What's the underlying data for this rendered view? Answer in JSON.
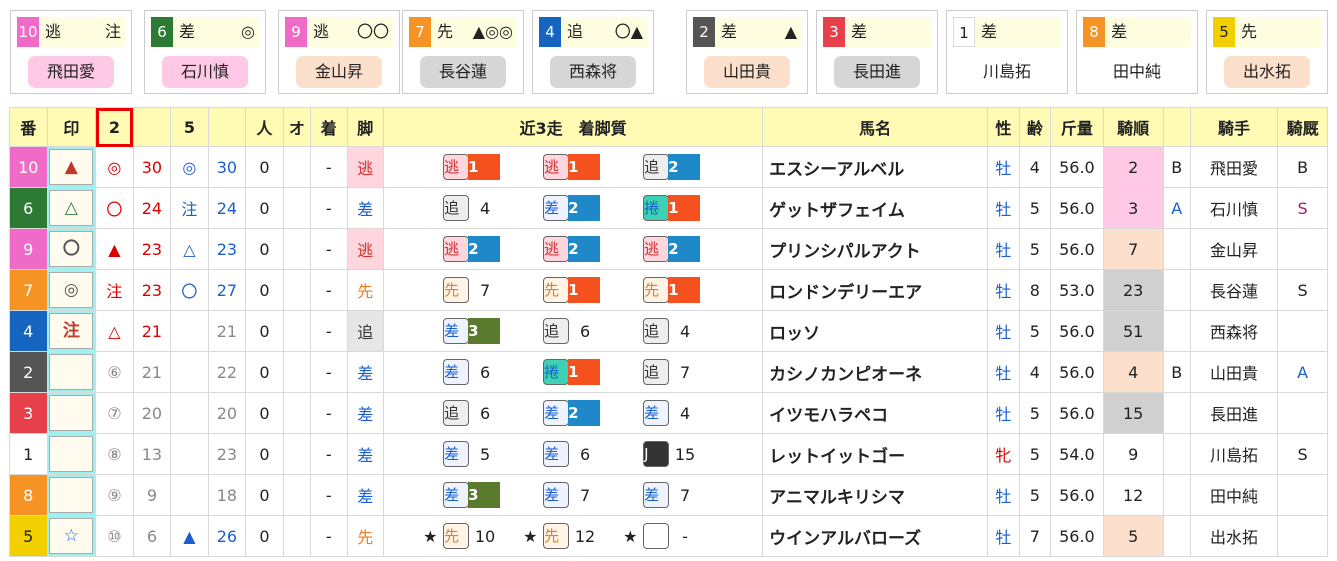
{
  "cards": [
    {
      "num": "10",
      "num_color": "#f06ac8",
      "style": "逃",
      "mark": "注",
      "jockey": "飛田愛",
      "jockey_bg": "#ffc9e6"
    },
    {
      "num": "6",
      "num_color": "#2d7a35",
      "style": "差",
      "mark": "◎",
      "jockey": "石川慎",
      "jockey_bg": "#ffc9e6"
    },
    {
      "num": "9",
      "num_color": "#f06ac8",
      "style": "逃",
      "mark": "〇〇",
      "jockey": "金山昇",
      "jockey_bg": "#fde0cc"
    },
    {
      "num": "7",
      "num_color": "#f59324",
      "style": "先",
      "mark": "▲◎◎",
      "jockey": "長谷蓮",
      "jockey_bg": "#d6d6d6"
    },
    {
      "num": "4",
      "num_color": "#1565c0",
      "style": "追",
      "mark": "〇▲",
      "jockey": "西森将",
      "jockey_bg": "#d6d6d6"
    },
    {
      "num": "2",
      "num_color": "#555555",
      "style": "差",
      "mark": "▲",
      "jockey": "山田貴",
      "jockey_bg": "#fde0cc"
    },
    {
      "num": "3",
      "num_color": "#e8404a",
      "style": "差",
      "mark": "",
      "jockey": "長田進",
      "jockey_bg": "#d6d6d6"
    },
    {
      "num": "1",
      "num_color": "#ffffff",
      "style": "差",
      "mark": "",
      "jockey": "川島拓",
      "jockey_bg": "#ffffff"
    },
    {
      "num": "8",
      "num_color": "#f59324",
      "style": "差",
      "mark": "",
      "jockey": "田中純",
      "jockey_bg": "#ffffff"
    },
    {
      "num": "5",
      "num_color": "#f2d000",
      "style": "先",
      "mark": "",
      "jockey": "出水拓",
      "jockey_bg": "#fde0cc"
    }
  ],
  "headers": {
    "ban": "番",
    "shirushi": "印",
    "sel2": "2",
    "col5": "5",
    "hito": "人",
    "o": "オ",
    "chaku": "着",
    "ashi": "脚",
    "recent": "近3走　着脚質",
    "name": "馬名",
    "sex": "性",
    "age": "齢",
    "weight": "斤量",
    "kijun": "騎順",
    "jockey": "騎手",
    "kihi": "騎厩"
  },
  "rows": [
    {
      "ban": "10",
      "ban_bg": "#f06ac8",
      "ban_fg": "#fff",
      "mark": "▲",
      "mark_color": "#c0392b",
      "m2": "◎",
      "m2c": "red",
      "v2": "30",
      "v2c": "red",
      "m5": "◎",
      "m5c": "blue",
      "v5": "30",
      "v5c": "blue",
      "hito": "0",
      "o": "",
      "chaku": "-",
      "ashi": "逃",
      "ashi_bg": "#ffd6dd",
      "ashi_fg": "#d32f2f",
      "runs": [
        {
          "star": "",
          "type": "逃",
          "type_fg": "#d32f2f",
          "type_bg": "#ffd6dd",
          "pos": "1",
          "pos_bg": "#f4511e"
        },
        {
          "star": "",
          "type": "逃",
          "type_fg": "#d32f2f",
          "type_bg": "#ffd6dd",
          "pos": "1",
          "pos_bg": "#f4511e"
        },
        {
          "star": "",
          "type": "追",
          "type_fg": "#333",
          "type_bg": "#eee",
          "pos": "2",
          "pos_bg": "#1e88c9"
        }
      ],
      "name": "エスシーアルベル",
      "sex": "牡",
      "sex_c": "blue",
      "age": "4",
      "weight": "56.0",
      "kijun": "2",
      "kijun_bg": "#ffc9e6",
      "b": "B",
      "b_c": "#222",
      "jockey": "飛田愛",
      "kihi": "B",
      "kihi_c": "#222"
    },
    {
      "ban": "6",
      "ban_bg": "#2d7a35",
      "ban_fg": "#fff",
      "mark": "△",
      "mark_color": "#2d7a35",
      "m2": "〇",
      "m2c": "red",
      "v2": "24",
      "v2c": "red",
      "m5": "注",
      "m5c": "blue",
      "v5": "24",
      "v5c": "blue",
      "hito": "0",
      "o": "",
      "chaku": "-",
      "ashi": "差",
      "ashi_bg": "#fff",
      "ashi_fg": "#1a5fd0",
      "runs": [
        {
          "star": "",
          "type": "追",
          "type_fg": "#333",
          "type_bg": "#eee",
          "pos": "4",
          "pos_bg": ""
        },
        {
          "star": "",
          "type": "差",
          "type_fg": "#1a5fd0",
          "type_bg": "#eef3ff",
          "pos": "2",
          "pos_bg": "#1e88c9"
        },
        {
          "star": "",
          "type": "捲",
          "type_fg": "#1a5fd0",
          "type_bg": "#3fd1b5",
          "pos": "1",
          "pos_bg": "#f4511e"
        }
      ],
      "name": "ゲットザフェイム",
      "sex": "牡",
      "sex_c": "blue",
      "age": "5",
      "weight": "56.0",
      "kijun": "3",
      "kijun_bg": "#ffc9e6",
      "b": "A",
      "b_c": "#1a5fd0",
      "jockey": "石川慎",
      "kihi": "S",
      "kihi_c": "#a0206a"
    },
    {
      "ban": "9",
      "ban_bg": "#f06ac8",
      "ban_fg": "#fff",
      "mark": "〇",
      "mark_color": "#555",
      "m2": "▲",
      "m2c": "red",
      "v2": "23",
      "v2c": "red",
      "m5": "△",
      "m5c": "blue",
      "v5": "23",
      "v5c": "blue",
      "hito": "0",
      "o": "",
      "chaku": "-",
      "ashi": "逃",
      "ashi_bg": "#ffd6dd",
      "ashi_fg": "#d32f2f",
      "runs": [
        {
          "star": "",
          "type": "逃",
          "type_fg": "#d32f2f",
          "type_bg": "#ffd6dd",
          "pos": "2",
          "pos_bg": "#1e88c9"
        },
        {
          "star": "",
          "type": "逃",
          "type_fg": "#d32f2f",
          "type_bg": "#ffd6dd",
          "pos": "2",
          "pos_bg": "#1e88c9"
        },
        {
          "star": "",
          "type": "逃",
          "type_fg": "#d32f2f",
          "type_bg": "#ffd6dd",
          "pos": "2",
          "pos_bg": "#1e88c9"
        }
      ],
      "name": "プリンシパルアクト",
      "sex": "牡",
      "sex_c": "blue",
      "age": "5",
      "weight": "56.0",
      "kijun": "7",
      "kijun_bg": "#fde0cc",
      "b": "",
      "b_c": "#222",
      "jockey": "金山昇",
      "kihi": "",
      "kihi_c": "#222"
    },
    {
      "ban": "7",
      "ban_bg": "#f59324",
      "ban_fg": "#fff",
      "mark": "◎",
      "mark_color": "#555",
      "m2": "注",
      "m2c": "red",
      "v2": "23",
      "v2c": "red",
      "m5": "〇",
      "m5c": "blue",
      "v5": "27",
      "v5c": "blue",
      "hito": "0",
      "o": "",
      "chaku": "-",
      "ashi": "先",
      "ashi_bg": "#fff",
      "ashi_fg": "#e67e22",
      "runs": [
        {
          "star": "",
          "type": "先",
          "type_fg": "#e67e22",
          "type_bg": "#fff4e6",
          "pos": "7",
          "pos_bg": ""
        },
        {
          "star": "",
          "type": "先",
          "type_fg": "#e67e22",
          "type_bg": "#fff4e6",
          "pos": "1",
          "pos_bg": "#f4511e"
        },
        {
          "star": "",
          "type": "先",
          "type_fg": "#e67e22",
          "type_bg": "#fff4e6",
          "pos": "1",
          "pos_bg": "#f4511e"
        }
      ],
      "name": "ロンドンデリーエア",
      "sex": "牡",
      "sex_c": "blue",
      "age": "8",
      "weight": "53.0",
      "kijun": "23",
      "kijun_bg": "#d0d0d0",
      "b": "",
      "b_c": "#222",
      "jockey": "長谷蓮",
      "kihi": "S",
      "kihi_c": "#222"
    },
    {
      "ban": "4",
      "ban_bg": "#1565c0",
      "ban_fg": "#fff",
      "mark": "注",
      "mark_color": "#c0392b",
      "m2": "△",
      "m2c": "red",
      "v2": "21",
      "v2c": "red",
      "m5": "",
      "m5c": "blue",
      "v5": "21",
      "v5c": "gray",
      "hito": "0",
      "o": "",
      "chaku": "-",
      "ashi": "追",
      "ashi_bg": "#e6e6e6",
      "ashi_fg": "#333",
      "runs": [
        {
          "star": "",
          "type": "差",
          "type_fg": "#1a5fd0",
          "type_bg": "#eef3ff",
          "pos": "3",
          "pos_bg": "#5a7a2e"
        },
        {
          "star": "",
          "type": "追",
          "type_fg": "#333",
          "type_bg": "#eee",
          "pos": "6",
          "pos_bg": ""
        },
        {
          "star": "",
          "type": "追",
          "type_fg": "#333",
          "type_bg": "#eee",
          "pos": "4",
          "pos_bg": ""
        }
      ],
      "name": "ロッソ",
      "sex": "牡",
      "sex_c": "blue",
      "age": "5",
      "weight": "56.0",
      "kijun": "51",
      "kijun_bg": "#d0d0d0",
      "b": "",
      "b_c": "#222",
      "jockey": "西森将",
      "kihi": "",
      "kihi_c": "#222"
    },
    {
      "ban": "2",
      "ban_bg": "#555",
      "ban_fg": "#fff",
      "mark": "",
      "mark_color": "#555",
      "m2": "⑥",
      "m2c": "gray",
      "v2": "21",
      "v2c": "gray",
      "m5": "",
      "m5c": "blue",
      "v5": "22",
      "v5c": "gray",
      "hito": "0",
      "o": "",
      "chaku": "-",
      "ashi": "差",
      "ashi_bg": "#fff",
      "ashi_fg": "#1a5fd0",
      "runs": [
        {
          "star": "",
          "type": "差",
          "type_fg": "#1a5fd0",
          "type_bg": "#eef3ff",
          "pos": "6",
          "pos_bg": ""
        },
        {
          "star": "",
          "type": "捲",
          "type_fg": "#1a5fd0",
          "type_bg": "#3fd1b5",
          "pos": "1",
          "pos_bg": "#f4511e"
        },
        {
          "star": "",
          "type": "追",
          "type_fg": "#333",
          "type_bg": "#eee",
          "pos": "7",
          "pos_bg": ""
        }
      ],
      "name": "カシノカンピオーネ",
      "sex": "牡",
      "sex_c": "blue",
      "age": "4",
      "weight": "56.0",
      "kijun": "4",
      "kijun_bg": "#fde0cc",
      "b": "B",
      "b_c": "#222",
      "jockey": "山田貴",
      "kihi": "A",
      "kihi_c": "#1a5fd0"
    },
    {
      "ban": "3",
      "ban_bg": "#e8404a",
      "ban_fg": "#fff",
      "mark": "",
      "mark_color": "#555",
      "m2": "⑦",
      "m2c": "gray",
      "v2": "20",
      "v2c": "gray",
      "m5": "",
      "m5c": "blue",
      "v5": "20",
      "v5c": "gray",
      "hito": "0",
      "o": "",
      "chaku": "-",
      "ashi": "差",
      "ashi_bg": "#fff",
      "ashi_fg": "#1a5fd0",
      "runs": [
        {
          "star": "",
          "type": "追",
          "type_fg": "#333",
          "type_bg": "#eee",
          "pos": "6",
          "pos_bg": ""
        },
        {
          "star": "",
          "type": "差",
          "type_fg": "#1a5fd0",
          "type_bg": "#eef3ff",
          "pos": "2",
          "pos_bg": "#1e88c9"
        },
        {
          "star": "",
          "type": "差",
          "type_fg": "#1a5fd0",
          "type_bg": "#eef3ff",
          "pos": "4",
          "pos_bg": ""
        }
      ],
      "name": "イツモハラペコ",
      "sex": "牡",
      "sex_c": "blue",
      "age": "5",
      "weight": "56.0",
      "kijun": "15",
      "kijun_bg": "#d0d0d0",
      "b": "",
      "b_c": "#222",
      "jockey": "長田進",
      "kihi": "",
      "kihi_c": "#222"
    },
    {
      "ban": "1",
      "ban_bg": "#fff",
      "ban_fg": "#222",
      "mark": "",
      "mark_color": "#555",
      "m2": "⑧",
      "m2c": "gray",
      "v2": "13",
      "v2c": "gray",
      "m5": "",
      "m5c": "blue",
      "v5": "23",
      "v5c": "gray",
      "hito": "0",
      "o": "",
      "chaku": "-",
      "ashi": "差",
      "ashi_bg": "#fff",
      "ashi_fg": "#1a5fd0",
      "runs": [
        {
          "star": "",
          "type": "差",
          "type_fg": "#1a5fd0",
          "type_bg": "#eef3ff",
          "pos": "5",
          "pos_bg": ""
        },
        {
          "star": "",
          "type": "差",
          "type_fg": "#1a5fd0",
          "type_bg": "#eef3ff",
          "pos": "6",
          "pos_bg": ""
        },
        {
          "star": "",
          "type": "J",
          "type_fg": "#fff",
          "type_bg": "#333",
          "pos": "15",
          "pos_bg": ""
        }
      ],
      "name": "レットイットゴー",
      "sex": "牝",
      "sex_c": "red",
      "age": "5",
      "weight": "54.0",
      "kijun": "9",
      "kijun_bg": "#fff",
      "b": "",
      "b_c": "#222",
      "jockey": "川島拓",
      "kihi": "S",
      "kihi_c": "#222"
    },
    {
      "ban": "8",
      "ban_bg": "#f59324",
      "ban_fg": "#fff",
      "mark": "",
      "mark_color": "#555",
      "m2": "⑨",
      "m2c": "gray",
      "v2": "9",
      "v2c": "gray",
      "m5": "",
      "m5c": "blue",
      "v5": "18",
      "v5c": "gray",
      "hito": "0",
      "o": "",
      "chaku": "-",
      "ashi": "差",
      "ashi_bg": "#fff",
      "ashi_fg": "#1a5fd0",
      "runs": [
        {
          "star": "",
          "type": "差",
          "type_fg": "#1a5fd0",
          "type_bg": "#eef3ff",
          "pos": "3",
          "pos_bg": "#5a7a2e"
        },
        {
          "star": "",
          "type": "差",
          "type_fg": "#1a5fd0",
          "type_bg": "#eef3ff",
          "pos": "7",
          "pos_bg": ""
        },
        {
          "star": "",
          "type": "差",
          "type_fg": "#1a5fd0",
          "type_bg": "#eef3ff",
          "pos": "7",
          "pos_bg": ""
        }
      ],
      "name": "アニマルキリシマ",
      "sex": "牡",
      "sex_c": "blue",
      "age": "5",
      "weight": "56.0",
      "kijun": "12",
      "kijun_bg": "#fff",
      "b": "",
      "b_c": "#222",
      "jockey": "田中純",
      "kihi": "",
      "kihi_c": "#222"
    },
    {
      "ban": "5",
      "ban_bg": "#f2d000",
      "ban_fg": "#222",
      "mark": "☆",
      "mark_color": "#2a6ad6",
      "m2": "⑩",
      "m2c": "gray",
      "v2": "6",
      "v2c": "gray",
      "m5": "▲",
      "m5c": "blue",
      "v5": "26",
      "v5c": "blue",
      "hito": "0",
      "o": "",
      "chaku": "-",
      "ashi": "先",
      "ashi_bg": "#fff",
      "ashi_fg": "#e67e22",
      "runs": [
        {
          "star": "★",
          "type": "先",
          "type_fg": "#e67e22",
          "type_bg": "#fff4e6",
          "pos": "10",
          "pos_bg": ""
        },
        {
          "star": "★",
          "type": "先",
          "type_fg": "#e67e22",
          "type_bg": "#fff4e6",
          "pos": "12",
          "pos_bg": ""
        },
        {
          "star": "★",
          "type": "",
          "type_fg": "#333",
          "type_bg": "#fff",
          "pos": "-",
          "pos_bg": ""
        }
      ],
      "name": "ウインアルバローズ",
      "sex": "牡",
      "sex_c": "blue",
      "age": "7",
      "weight": "56.0",
      "kijun": "5",
      "kijun_bg": "#fde0cc",
      "b": "",
      "b_c": "#222",
      "jockey": "出水拓",
      "kihi": "",
      "kihi_c": "#222"
    }
  ]
}
